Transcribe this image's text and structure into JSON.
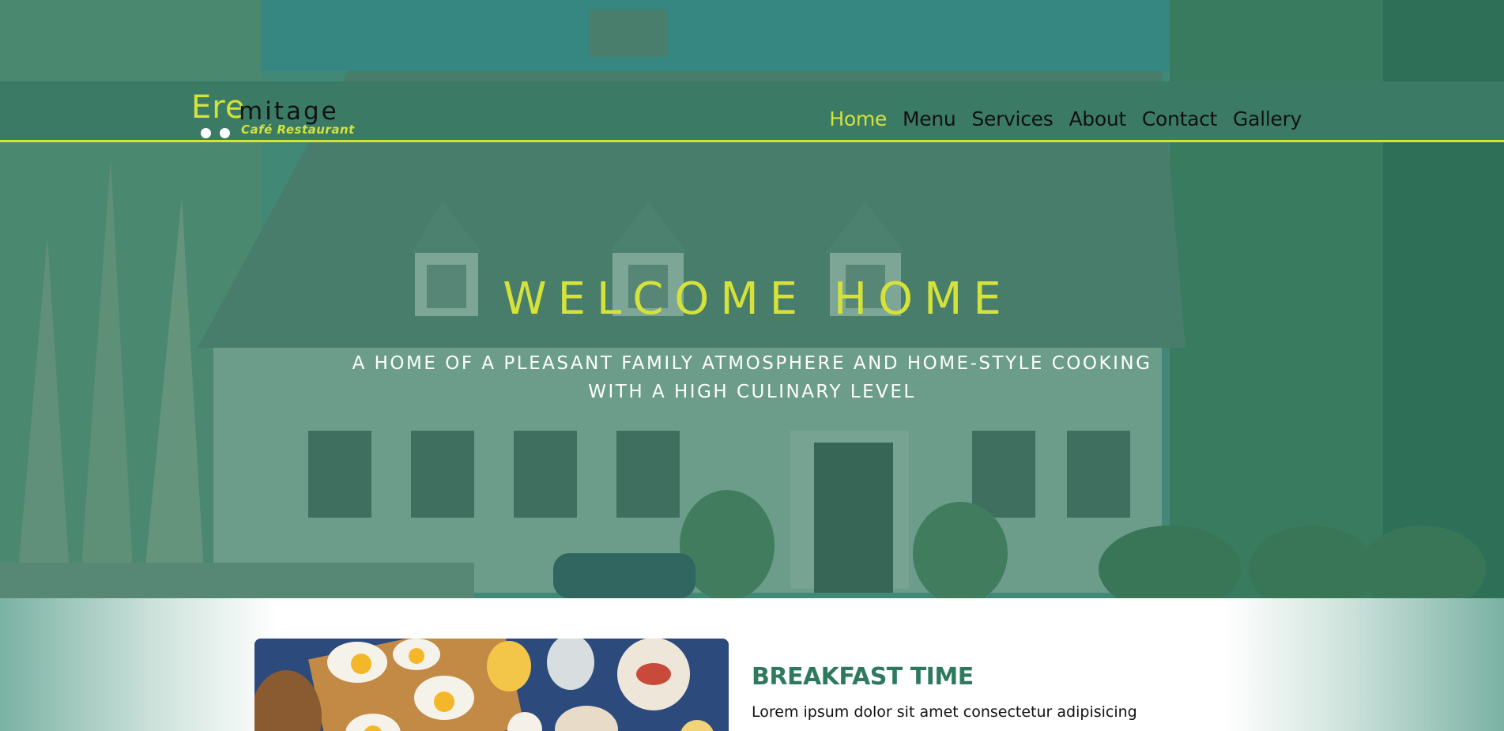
{
  "brand": {
    "name_part1": "Ere",
    "name_part2": "mitage",
    "tagline": "Café Restaurant"
  },
  "nav": {
    "items": [
      {
        "label": "Home",
        "active": true
      },
      {
        "label": "Menu",
        "active": false
      },
      {
        "label": "Services",
        "active": false
      },
      {
        "label": "About",
        "active": false
      },
      {
        "label": "Contact",
        "active": false
      },
      {
        "label": "Gallery",
        "active": false
      }
    ]
  },
  "hero": {
    "title": "WELCOME HOME",
    "subtitle_line1": "A HOME OF A PLEASANT FAMILY ATMOSPHERE AND HOME-STYLE COOKING",
    "subtitle_line2": "WITH A HIGH CULINARY LEVEL"
  },
  "section": {
    "title": "BREAKFAST TIME",
    "text": "Lorem ipsum dolor sit amet consectetur adipisicing"
  },
  "colors": {
    "accent": "#d4e23a",
    "nav_bg": "#3b7b66",
    "section_title": "#2f7a5f"
  }
}
